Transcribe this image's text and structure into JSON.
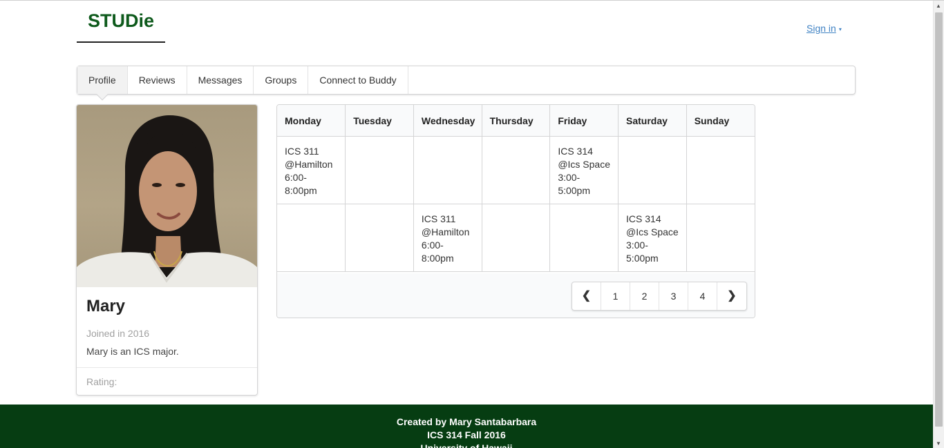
{
  "header": {
    "brand": "STUDie",
    "signin_label": "Sign in",
    "signin_caret": "▾"
  },
  "tabs": [
    {
      "label": "Profile",
      "active": true
    },
    {
      "label": "Reviews"
    },
    {
      "label": "Messages"
    },
    {
      "label": "Groups"
    },
    {
      "label": "Connect to Buddy"
    }
  ],
  "profile": {
    "name": "Mary",
    "meta": "Joined in 2016",
    "description": "Mary is an ICS major.",
    "extra": "Rating:"
  },
  "schedule": {
    "headers": [
      "Monday",
      "Tuesday",
      "Wednesday",
      "Thursday",
      "Friday",
      "Saturday",
      "Sunday"
    ],
    "rows": [
      [
        [
          "ICS 311",
          "@Hamilton",
          "6:00-",
          "8:00pm"
        ],
        [],
        [],
        [],
        [
          "ICS 314",
          "@Ics Space",
          "3:00-",
          "5:00pm"
        ],
        [],
        []
      ],
      [
        [],
        [],
        [
          "ICS 311",
          "@Hamilton",
          "6:00-",
          "8:00pm"
        ],
        [],
        [],
        [
          "ICS 314",
          "@Ics Space",
          "3:00-",
          "5:00pm"
        ],
        []
      ]
    ],
    "pagination": {
      "prev_icon": "chevron-left-icon",
      "next_icon": "chevron-right-icon",
      "pages": [
        "1",
        "2",
        "3",
        "4"
      ]
    }
  },
  "footer": {
    "line1": "Created by Mary Santabarbara",
    "line2": "ICS 314 Fall 2016",
    "line3": "University of Hawaii"
  },
  "colors": {
    "brand": "#0e5a1c",
    "footer_bg": "#063d12",
    "link": "#4183c4"
  }
}
